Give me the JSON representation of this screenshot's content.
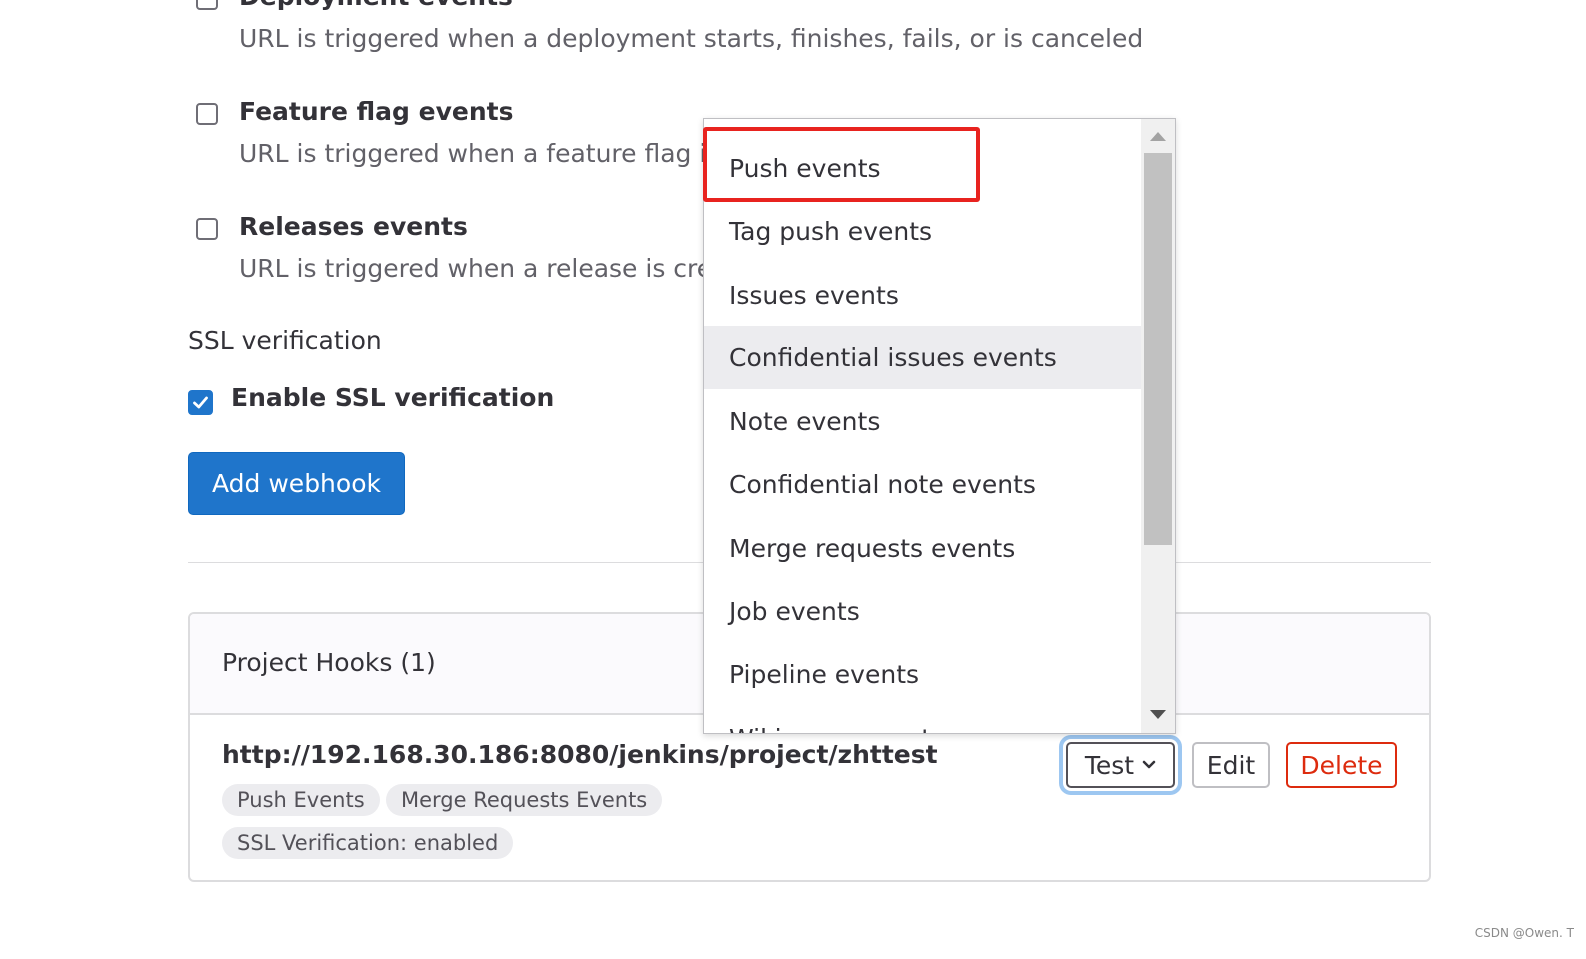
{
  "events": [
    {
      "title": "Deployment events",
      "description": "URL is triggered when a deployment starts, finishes, fails, or is canceled",
      "checked": false
    },
    {
      "title": "Feature flag events",
      "description": "URL is triggered when a feature flag is",
      "checked": false
    },
    {
      "title": "Releases events",
      "description": "URL is triggered when a release is crea",
      "checked": false
    }
  ],
  "ssl": {
    "section_title": "SSL verification",
    "checkbox_label": "Enable SSL verification",
    "checked": true
  },
  "add_button_label": "Add webhook",
  "hooks": {
    "title": "Project Hooks (1)",
    "url": "http://192.168.30.186:8080/jenkins/project/zhttest",
    "badges": [
      "Push Events",
      "Merge Requests Events",
      "SSL Verification: enabled"
    ],
    "test_label": "Test",
    "edit_label": "Edit",
    "delete_label": "Delete"
  },
  "dropdown": {
    "items": [
      "Push events",
      "Tag push events",
      "Issues events",
      "Confidential issues events",
      "Note events",
      "Confidential note events",
      "Merge requests events",
      "Job events",
      "Pipeline events",
      "Wiki page events"
    ],
    "hovered": "Confidential issues events",
    "annotated": "Push events"
  },
  "watermark": "CSDN @Owen. T",
  "colors": {
    "primary": "#1f75cb",
    "danger": "#dd2b0e",
    "annotation": "#e8231f"
  }
}
